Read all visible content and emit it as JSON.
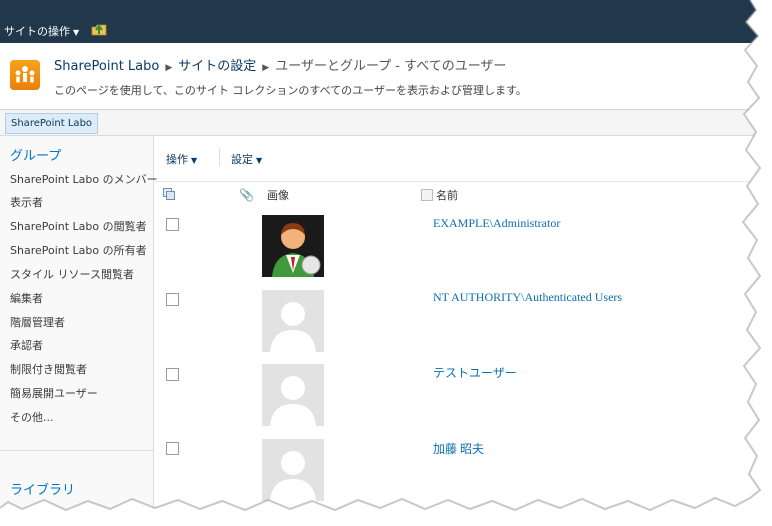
{
  "ribbon": {
    "site_actions_label": "サイトの操作",
    "nav_up_icon": "navigate-up-icon"
  },
  "title_area": {
    "breadcrumb": [
      "SharePoint Labo",
      "サイトの設定",
      "ユーザーとグループ - すべてのユーザー"
    ],
    "description": "このページを使用して、このサイト コレクションのすべてのユーザーを表示および管理します。",
    "logo_icon": "site-logo-icon"
  },
  "top_nav": {
    "items": [
      "SharePoint Labo"
    ]
  },
  "quick_launch": {
    "groups_heading": "グループ",
    "groups": [
      "SharePoint Labo のメンバー",
      "表示者",
      "SharePoint Labo の閲覧者",
      "SharePoint Labo の所有者",
      "スタイル リソース閲覧者",
      "編集者",
      "階層管理者",
      "承認者",
      "制限付き閲覧者",
      "簡易展開ユーザー",
      "その他..."
    ],
    "libraries_heading": "ライブラリ"
  },
  "toolbar": {
    "actions_label": "操作",
    "settings_label": "設定"
  },
  "list": {
    "columns": {
      "picture": "画像",
      "name": "名前"
    },
    "users": [
      {
        "name": "EXAMPLE\\Administrator",
        "picture": "administrator-avatar"
      },
      {
        "name": "NT AUTHORITY\\Authenticated Users",
        "picture": "default-avatar"
      },
      {
        "name": "テストユーザー",
        "picture": "default-avatar"
      },
      {
        "name": "加藤 昭夫",
        "picture": "default-avatar"
      }
    ]
  },
  "colors": {
    "ribbon": "#21374c",
    "link": "#0b6fb3",
    "accent": "#0072c6"
  }
}
